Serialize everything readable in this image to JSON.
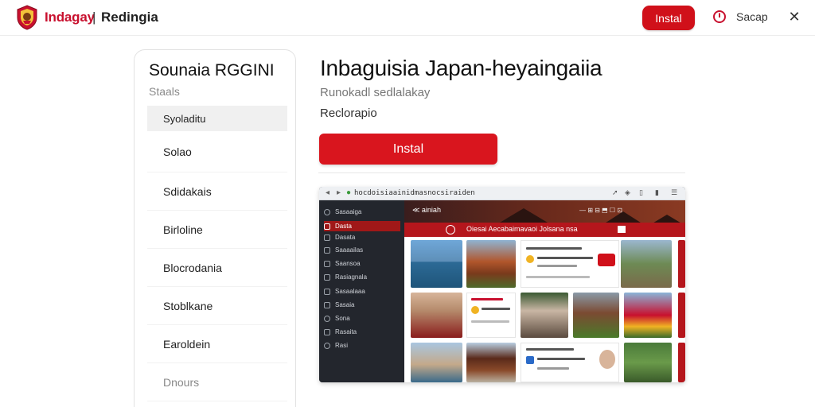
{
  "header": {
    "brand_name": "Indagay",
    "separator": "|",
    "brand_sub": "Redingia",
    "install_label": "Instal",
    "help_label": "Sacap",
    "close_glyph": "✕"
  },
  "sidebar": {
    "title": "Sounaia RGGINI",
    "subtitle": "Staals",
    "items": [
      {
        "label": "Syoladitu"
      },
      {
        "label": "Solao"
      },
      {
        "label": "Sdidakais"
      },
      {
        "label": "Birloline"
      },
      {
        "label": "Blocrodania"
      },
      {
        "label": "Stoblkane"
      },
      {
        "label": "Earoldein"
      },
      {
        "label": "Dnours"
      }
    ]
  },
  "main": {
    "title": "Inbaguisia Japan-heyaingaiia",
    "subtitle": "Runokadl sedlalakay",
    "meta": "Reclorapio",
    "install_label": "Instal"
  },
  "preview": {
    "url": "hocdoisiaainidmasnocsiraiden",
    "hero_nav": "≪ ainiah",
    "hero_tools": "— ⊞ ⊟  ⬒  ☐  ⊡",
    "banner_text": "Oiesai Aecabaimavaoi Jolsana nsa",
    "side_items": [
      {
        "label": "Sasaaiga"
      },
      {
        "label": "Dasta"
      },
      {
        "label": "Dasata"
      },
      {
        "label": "Saaaailas"
      },
      {
        "label": "Saansoa"
      },
      {
        "label": "Rasiagnala"
      },
      {
        "label": "Sasaalaaa"
      },
      {
        "label": "Sasaia"
      },
      {
        "label": "Sona"
      },
      {
        "label": "Rasaita"
      },
      {
        "label": "Rasi"
      }
    ]
  },
  "colors": {
    "brand_red": "#c8102e",
    "button_red": "#d9151e",
    "sidebar_active_bg": "#f0f0f0",
    "preview_dark": "#23262d"
  },
  "icons": {
    "brand": "emblem-icon",
    "help": "circle-info-icon",
    "close": "close-icon"
  }
}
